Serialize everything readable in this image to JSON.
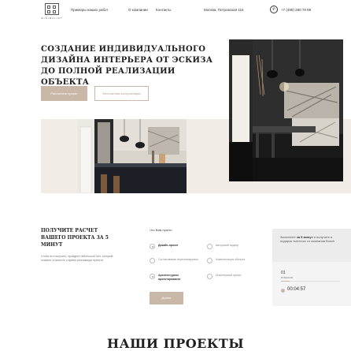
{
  "header": {
    "logo_text": "MINIMALIST",
    "nav": [
      "Примеры наших работ",
      "О компании",
      "Контакты"
    ],
    "address": "Москва, Петровская 116",
    "phone": "+7 (495) 280 78 89"
  },
  "hero": {
    "title": "Создание индивидуального дизайна интерьера от эскиза до полной реализации объекта",
    "primary_button": "Рассчитать проект",
    "secondary_button": "Бесплатная консультация"
  },
  "quiz": {
    "title": "Получите расчет вашего проекта за 5 минут",
    "description": "Чтобы это получить, пройдите небольшой тест, который покажет стоимость и время реализации проекта",
    "question": "Что Вам нужно:",
    "options": [
      {
        "label": "Дизайн-проект",
        "selected": true
      },
      {
        "label": "Авторский надзор",
        "selected": false
      },
      {
        "label": "Согласование перепланировки",
        "selected": false
      },
      {
        "label": "Комплектация объекта",
        "selected": false
      },
      {
        "label": "Архитектурное проектирование",
        "selected": true
      },
      {
        "label": "Инженерный проект",
        "selected": false
      }
    ],
    "next_button": "Далее",
    "side": {
      "prize_prefix": "Заполните",
      "prize_highlight": "за 5 минут",
      "prize_suffix": "и получите в подарок тьелесос от компании Bosch",
      "step": "01",
      "step_label": "вопросов",
      "progress": 0.15,
      "timer": "00:04:57"
    }
  },
  "projects": {
    "title": "Наши проекты"
  },
  "colors": {
    "accent": "#c9b7a7",
    "band": "#f2ece7",
    "text": "#1f1f1f"
  }
}
